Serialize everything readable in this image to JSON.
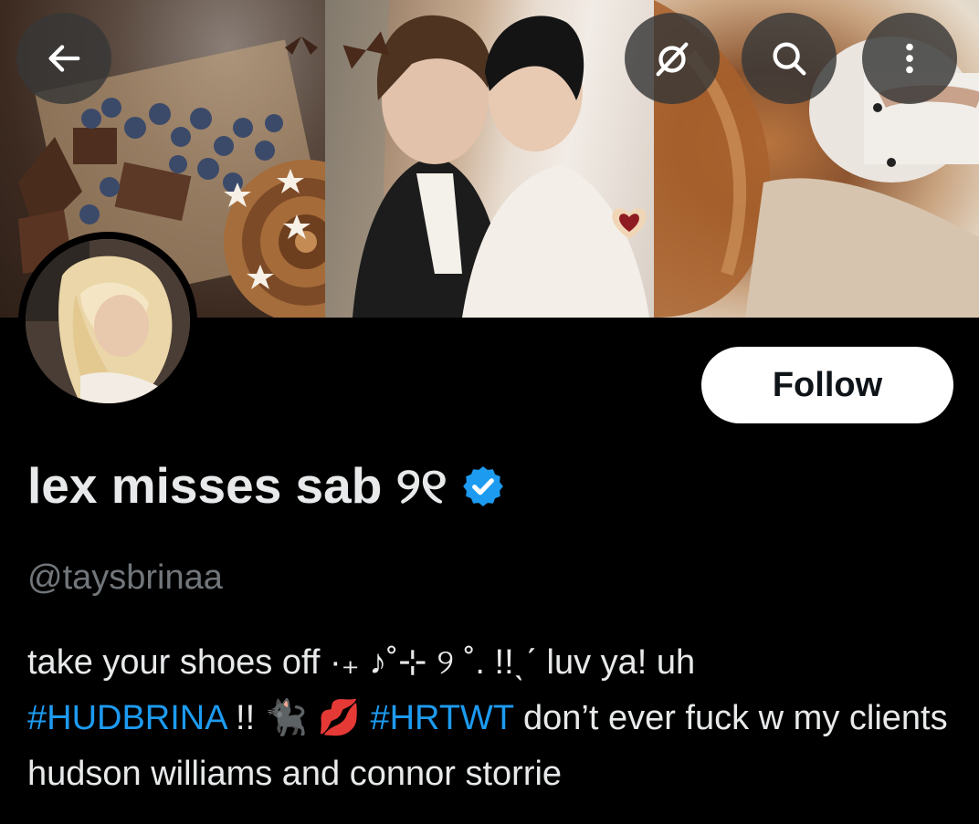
{
  "colors": {
    "background": "#000000",
    "text_primary": "#e7e9ea",
    "text_secondary": "#71767b",
    "link": "#1d9bf0",
    "verified_badge": "#1d9bf0",
    "follow_button_bg": "#ffffff",
    "follow_button_text": "#0f1419"
  },
  "header": {
    "back_icon": "arrow-left-icon",
    "mute_icon": "mute-circle-slash-icon",
    "search_icon": "search-icon",
    "more_icon": "more-vertical-icon"
  },
  "profile": {
    "display_name": "lex misses sab ୨୧",
    "handle": "@taysbrinaa",
    "verified": true,
    "follow_label": "Follow",
    "bio": {
      "line1": "take your shoes off ·₊ ♪˚⊹ ୨ ˚. !!ˎˊ luv ya! uh",
      "tag1": "#HUDBRINA",
      "mid": " !! 🐈‍⬛ 💋 ",
      "tag2": "#HRTWT",
      "tail": " don’t ever fuck w my clients hudson williams and connor storrie"
    }
  }
}
